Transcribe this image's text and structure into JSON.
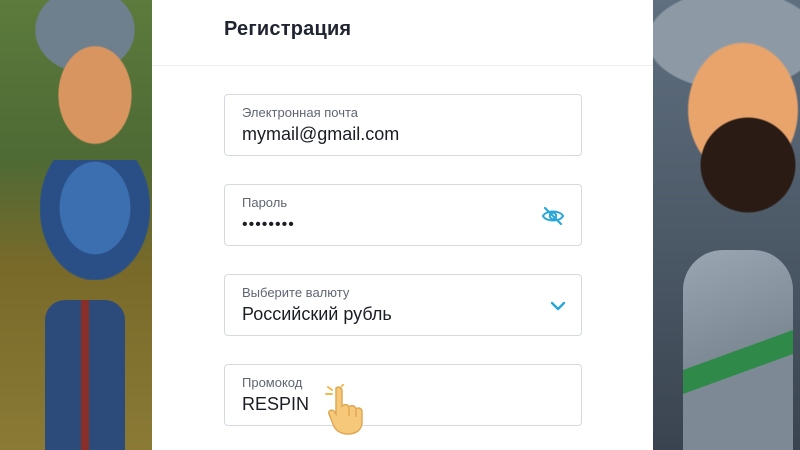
{
  "form": {
    "title": "Регистрация",
    "email": {
      "label": "Электронная почта",
      "value": "mymail@gmail.com"
    },
    "password": {
      "label": "Пароль",
      "value": "••••••••",
      "icon": "eye-off-icon"
    },
    "currency": {
      "label": "Выберите валюту",
      "value": "Российский рубль",
      "icon": "chevron-down-icon"
    },
    "promo": {
      "label": "Промокод",
      "value": "RESPIN"
    }
  },
  "colors": {
    "accent": "#2aa7d8",
    "border": "#d6dae0",
    "text": "#1a1d24",
    "label": "#5f6673"
  },
  "cursor": {
    "icon": "pointing-hand-icon"
  }
}
